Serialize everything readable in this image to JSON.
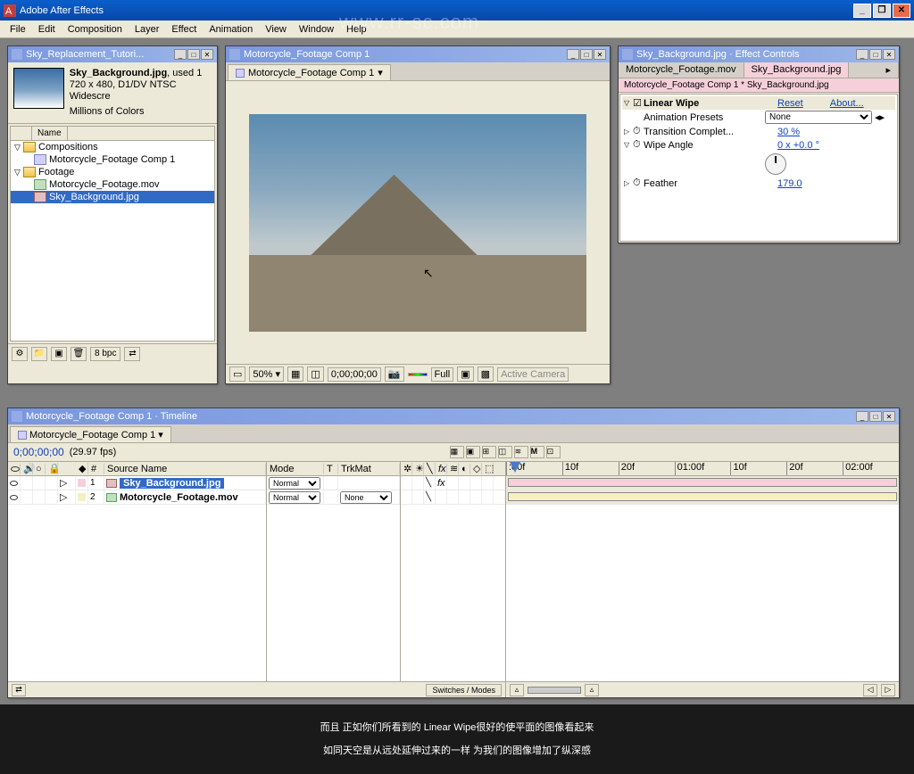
{
  "app": {
    "title": "Adobe After Effects"
  },
  "menu": [
    "File",
    "Edit",
    "Composition",
    "Layer",
    "Effect",
    "Animation",
    "View",
    "Window",
    "Help"
  ],
  "project": {
    "panel_title": "Sky_Replacement_Tutori...",
    "sel_name": "Sky_Background.jpg",
    "sel_used": ", used 1",
    "sel_dims": "720 x 480, D1/DV NTSC Widescre",
    "sel_colors": "Millions of Colors",
    "col_name": "Name",
    "items": {
      "comp_folder": "Compositions",
      "comp1": "Motorcycle_Footage Comp 1",
      "footage_folder": "Footage",
      "mov": "Motorcycle_Footage.mov",
      "img": "Sky_Background.jpg"
    },
    "bpc": "8 bpc"
  },
  "comp": {
    "panel_title": "Motorcycle_Footage Comp 1",
    "tab": "Motorcycle_Footage Comp 1",
    "zoom": "50%",
    "time": "0;00;00;00",
    "res": "Full",
    "camera": "Active Camera"
  },
  "ecw": {
    "panel_title": "Sky_Background.jpg · Effect Controls",
    "tab1": "Motorcycle_Footage.mov",
    "tab2": "Sky_Background.jpg",
    "subline": "Motorcycle_Footage Comp 1 * Sky_Background.jpg",
    "fx_name": "Linear Wipe",
    "reset": "Reset",
    "about": "About...",
    "preset_label": "Animation Presets",
    "preset_value": "None",
    "p1_label": "Transition Complet...",
    "p1_value": "30 %",
    "p2_label": "Wipe Angle",
    "p2_value": "0 x +0.0 °",
    "p3_label": "Feather",
    "p3_value": "179.0"
  },
  "timeline": {
    "panel_title": "Motorcycle_Footage Comp 1 · Timeline",
    "tab": "Motorcycle_Footage Comp 1",
    "time": "0;00;00;00",
    "fps": "(29.97 fps)",
    "col_num": "#",
    "col_src": "Source Name",
    "col_mode": "Mode",
    "col_t": "T",
    "col_trkmat": "TrkMat",
    "layers": [
      {
        "n": "1",
        "name": "Sky_Background.jpg",
        "mode": "Normal",
        "trkmat": ""
      },
      {
        "n": "2",
        "name": "Motorcycle_Footage.mov",
        "mode": "Normal",
        "trkmat": "None"
      }
    ],
    "ruler": [
      ":00f",
      "10f",
      "20f",
      "01:00f",
      "10f",
      "20f",
      "02:00f"
    ],
    "switches_label": "Switches / Modes"
  },
  "subtitle": {
    "line1": "而且 正如你们所看到的 Linear Wipe很好的使平面的图像看起来",
    "line2": "如同天空是从远处延伸过来的一样 为我们的图像增加了纵深感"
  },
  "watermark": "www.rr-sc.com"
}
